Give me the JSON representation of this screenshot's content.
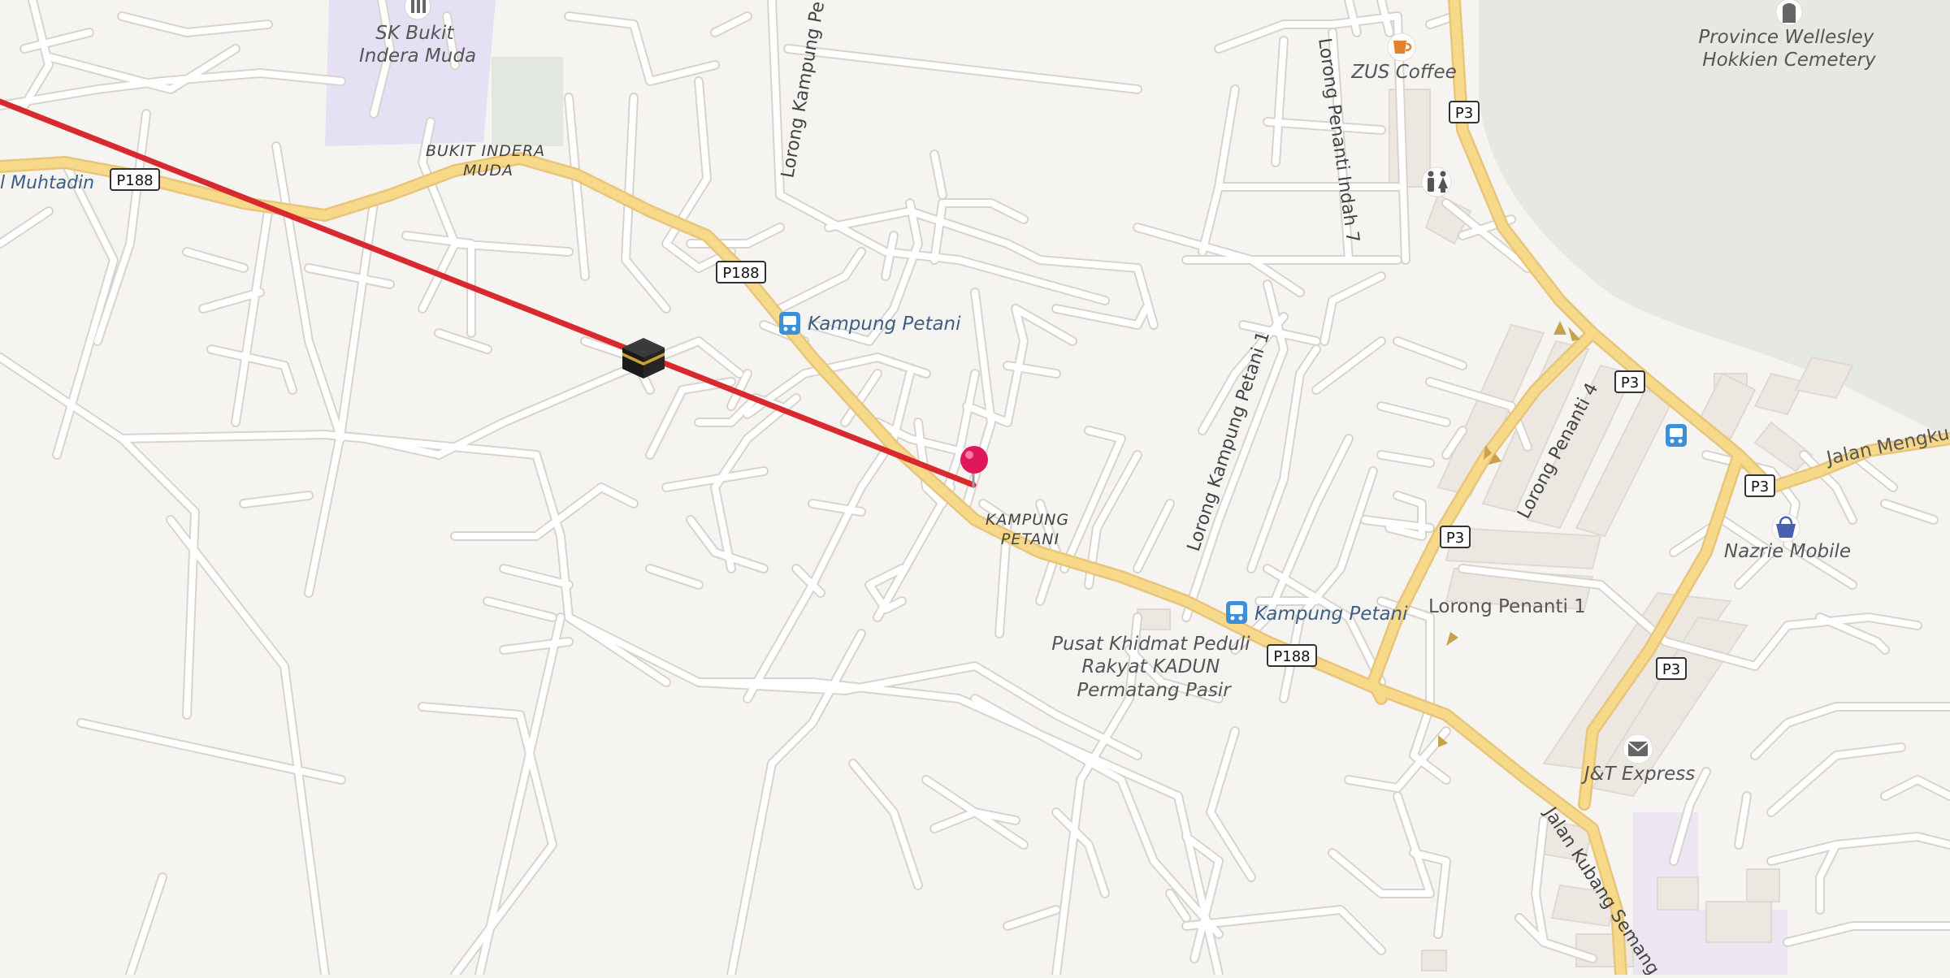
{
  "map": {
    "places": {
      "sk_bukit_indera_muda": "SK Bukit\nIndera Muda",
      "bukit_indera_muda": "BUKIT INDERA\nMUDA",
      "kampung_petani_area": "KAMPUNG\nPETANI",
      "muhtadin": "l Muhtadin",
      "zus_coffee": "ZUS Coffee",
      "hokkien_cemetery": "Province Wellesley\nHokkien Cemetery",
      "nazrie_mobile": "Nazrie Mobile",
      "jt_express": "J&T Express",
      "pusat_khidmat": "Pusat Khidmat Peduli\nRakyat KADUN\nPermatang Pasir"
    },
    "bus_stops": {
      "kampung_petani_1": "Kampung Petani",
      "kampung_petani_2": "Kampung Petani"
    },
    "streets": {
      "lorong_kampung_pe": "Lorong Kampung Pe",
      "lorong_penanti_indah_7": "Lorong Penanti Indah 7",
      "lorong_kampung_petani_1": "Lorong Kampung Petani 1",
      "lorong_penanti_4": "Lorong Penanti 4",
      "lorong_penanti_1": "Lorong Penanti 1",
      "jalan_kubang_semang": "Jalan Kubang Semang",
      "jalan_mengkuang": "Jalan Mengkuang"
    },
    "shields": {
      "p188": "P188",
      "p3": "P3"
    },
    "colors": {
      "background": "#f6f4f0",
      "main_road": "#f7d98a",
      "minor_road": "#ffffff",
      "water": "#e6e8e2",
      "school_area": "#e6e0f4",
      "qibla_line": "#d82a2e",
      "pin": "#e0185a",
      "bus_icon": "#3d8fd8"
    },
    "icons": [
      "kaaba-icon",
      "location-pin-icon",
      "bus-stop-icon",
      "coffee-icon",
      "restroom-icon",
      "cemetery-icon",
      "shopping-basket-icon",
      "mail-icon",
      "school-icon"
    ]
  }
}
